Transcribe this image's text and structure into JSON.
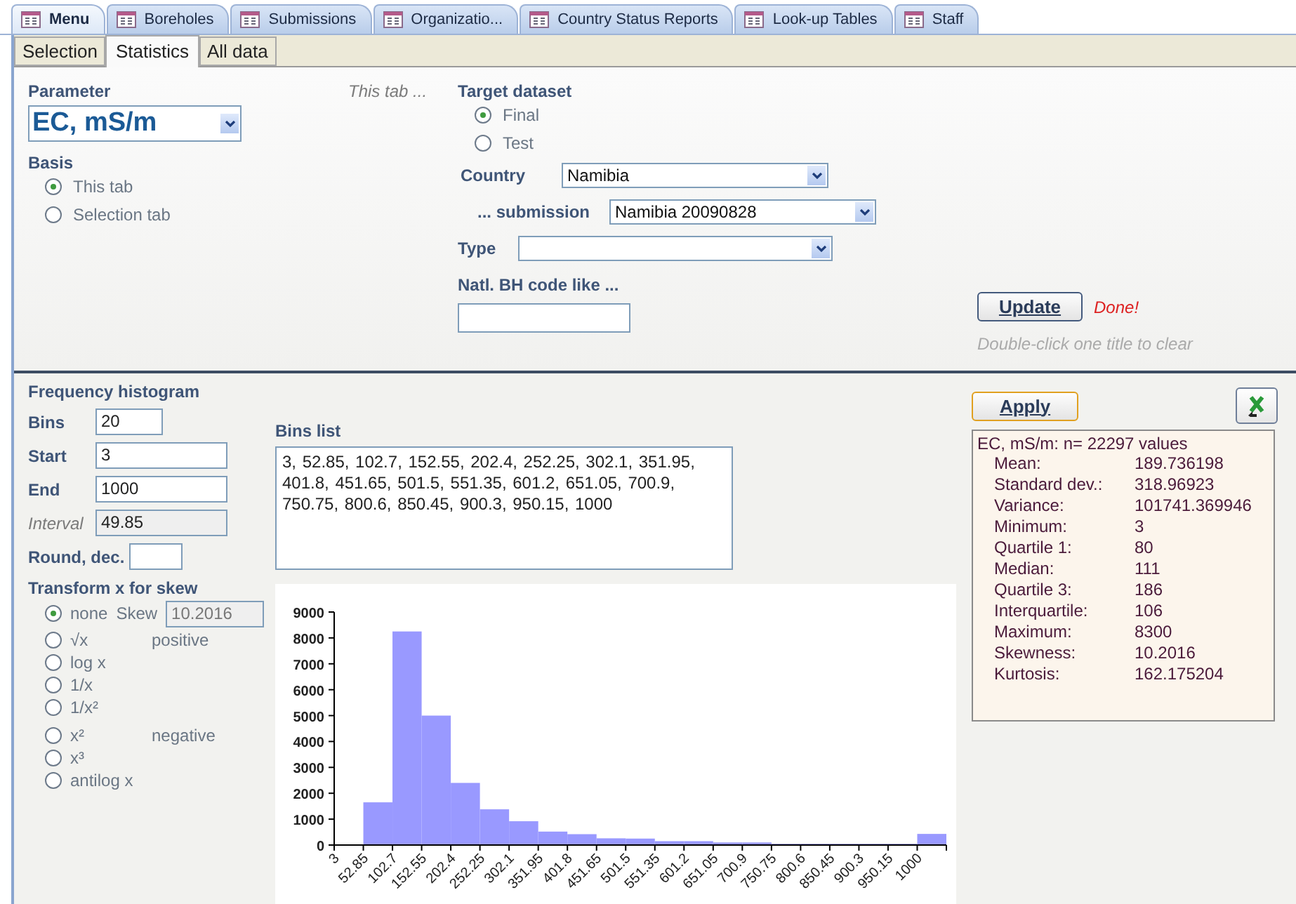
{
  "doc_tabs": [
    {
      "label": "Menu",
      "selected": true
    },
    {
      "label": "Boreholes",
      "selected": false
    },
    {
      "label": "Submissions",
      "selected": false
    },
    {
      "label": "Organizatio...",
      "selected": false
    },
    {
      "label": "Country Status Reports",
      "selected": false
    },
    {
      "label": "Look-up Tables",
      "selected": false
    },
    {
      "label": "Staff",
      "selected": false
    }
  ],
  "sub_tabs": [
    {
      "label": "Selection",
      "selected": false
    },
    {
      "label": "Statistics",
      "selected": true
    },
    {
      "label": "All data",
      "selected": false
    }
  ],
  "parameter": {
    "label": "Parameter",
    "value": "EC, mS/m"
  },
  "basis": {
    "label": "Basis",
    "options": [
      {
        "label": "This tab",
        "selected": true
      },
      {
        "label": "Selection tab",
        "selected": false
      }
    ]
  },
  "this_tab_note": "This tab ...",
  "target": {
    "label": "Target dataset",
    "options": [
      {
        "label": "Final",
        "selected": true
      },
      {
        "label": "Test",
        "selected": false
      }
    ]
  },
  "country": {
    "label": "Country",
    "value": "Namibia"
  },
  "submission": {
    "label": "... submission",
    "value": "Namibia 20090828"
  },
  "type": {
    "label": "Type"
  },
  "bh_code": {
    "label": "Natl. BH code like ..."
  },
  "update_button": {
    "label": "Update",
    "status": "Done!"
  },
  "hint": "Double-click one title to clear",
  "histogram": {
    "title": "Frequency histogram",
    "fields": [
      {
        "label": "Bins",
        "value": "20",
        "kind": "short"
      },
      {
        "label": "Start",
        "value": "3",
        "kind": "long"
      },
      {
        "label": "End",
        "value": "1000",
        "kind": "long"
      },
      {
        "label": "Interval",
        "value": "49.85",
        "kind": "computed"
      },
      {
        "label": "Round, dec.",
        "kind": "round"
      }
    ],
    "bins_list_label": "Bins list",
    "bins_list": "3,  52.85,  102.7,  152.55,  202.4,  252.25,  302.1,  351.95,  401.8,  451.65,  501.5,  551.35,  601.2,  651.05,  700.9,  750.75,  800.6,  850.45,  900.3,  950.15,  1000",
    "transform_title": "Transform x for skew",
    "skew_label": "Skew",
    "skew_value": "10.2016",
    "transforms": [
      {
        "label": "none",
        "selected": true
      },
      {
        "label": "√x",
        "note": "positive",
        "selected": false
      },
      {
        "label": "log x",
        "selected": false
      },
      {
        "label": "1/x",
        "selected": false
      },
      {
        "label": "1/x²",
        "selected": false
      },
      {
        "label": "x²",
        "note": "negative",
        "selected": false
      },
      {
        "label": "x³",
        "selected": false
      },
      {
        "label": "antilog x",
        "selected": false
      }
    ],
    "chart_data": {
      "type": "bar",
      "categories": [
        "3",
        "52.85",
        "102.7",
        "152.55",
        "202.4",
        "252.25",
        "302.1",
        "351.95",
        "401.8",
        "451.65",
        "501.5",
        "551.35",
        "601.2",
        "651.05",
        "700.9",
        "750.75",
        "800.6",
        "850.45",
        "900.3",
        "950.15",
        "1000"
      ],
      "series": [
        {
          "color": "#9999ff",
          "values": [
            0,
            1650,
            8250,
            5000,
            2400,
            1380,
            920,
            520,
            420,
            260,
            250,
            150,
            150,
            100,
            100,
            50,
            50,
            50,
            50,
            50,
            430
          ]
        }
      ],
      "ylim": [
        0,
        9000
      ],
      "yticks": [
        0,
        1000,
        2000,
        3000,
        4000,
        5000,
        6000,
        7000,
        8000,
        9000
      ]
    }
  },
  "apply_button": "Apply",
  "stats": {
    "header": "EC, mS/m: n= 22297 values",
    "rows": [
      {
        "label": "Mean:",
        "value": "189.736198"
      },
      {
        "label": "Standard dev.:",
        "value": "318.96923"
      },
      {
        "label": "Variance:",
        "value": "101741.369946"
      },
      {
        "label": "Minimum:",
        "value": "3"
      },
      {
        "label": "Quartile 1:",
        "value": "80"
      },
      {
        "label": "Median:",
        "value": "111"
      },
      {
        "label": "Quartile 3:",
        "value": "186"
      },
      {
        "label": "Interquartile:",
        "value": "106"
      },
      {
        "label": "Maximum:",
        "value": "8300"
      },
      {
        "label": "Skewness:",
        "value": "10.2016"
      },
      {
        "label": "Kurtosis:",
        "value": "162.175204"
      }
    ]
  }
}
